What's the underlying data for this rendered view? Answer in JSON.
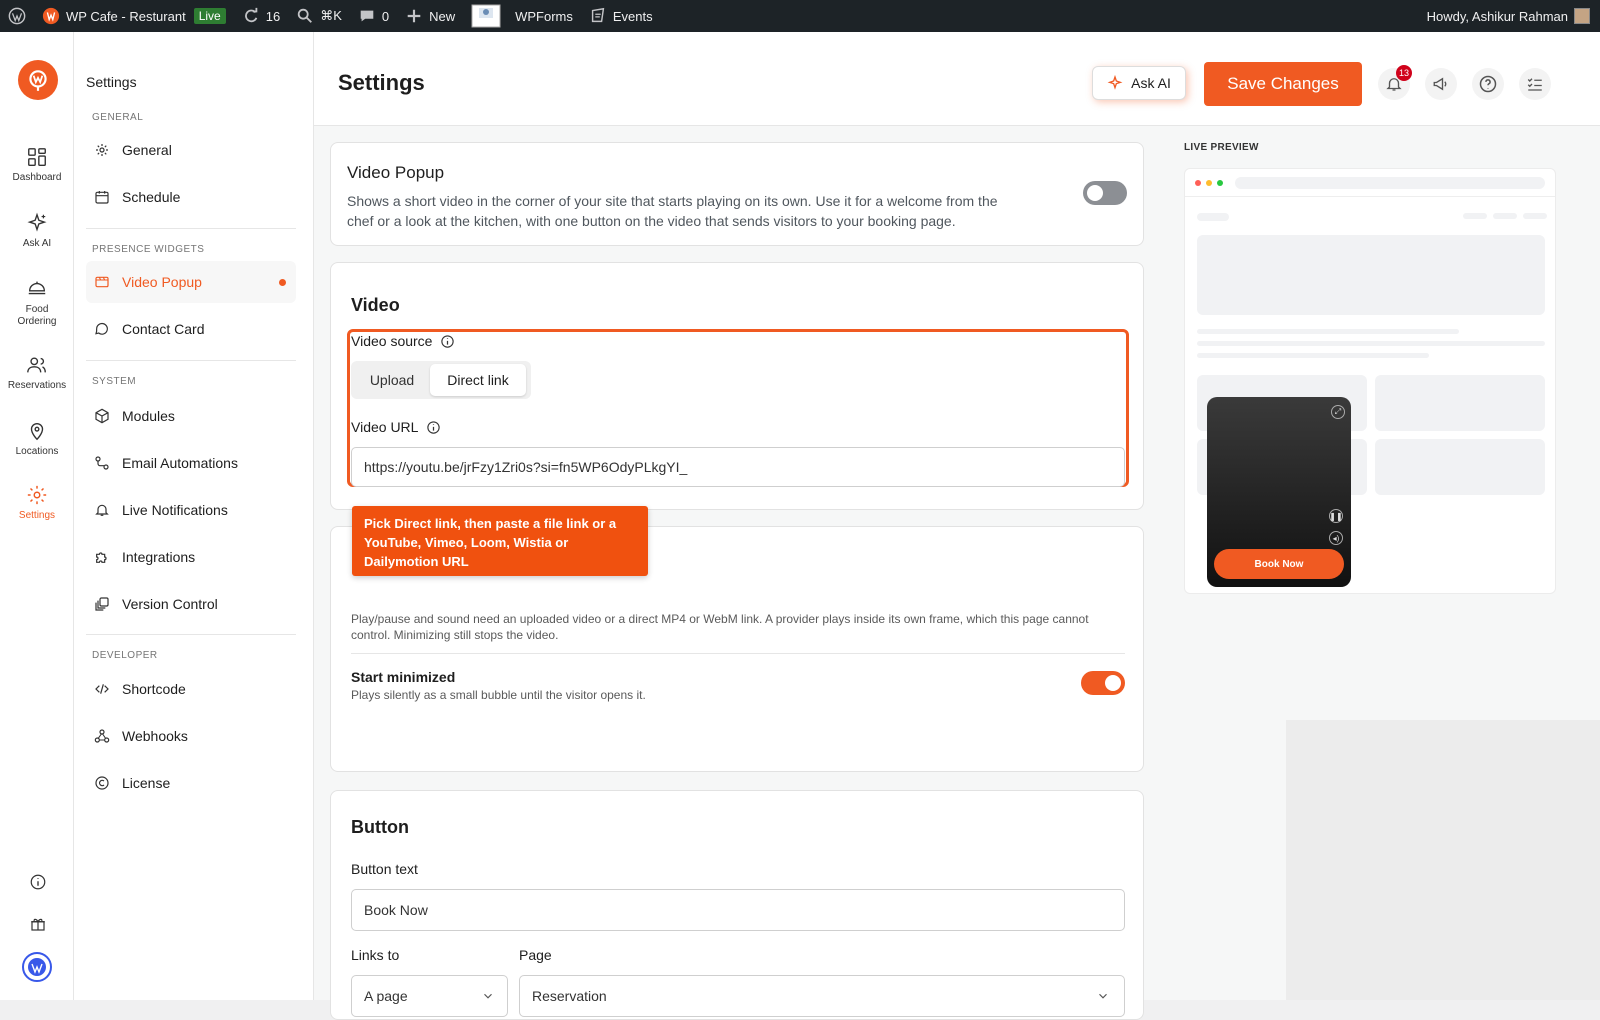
{
  "admin_bar": {
    "site_name": "WP Cafe - Resturant",
    "live_badge": "Live",
    "updates_count": "16",
    "search_shortcut": "⌘K",
    "comments_count": "0",
    "new_label": "New",
    "wpforms_label": "WPForms",
    "events_label": "Events",
    "greeting": "Howdy, Ashikur Rahman"
  },
  "icon_rail": {
    "items": [
      {
        "label": "Dashboard",
        "icon": "dashboard-icon"
      },
      {
        "label": "Ask AI",
        "icon": "sparkle-icon"
      },
      {
        "label": "Food Ordering",
        "icon": "food-icon"
      },
      {
        "label": "Reservations",
        "icon": "users-icon"
      },
      {
        "label": "Locations",
        "icon": "location-icon"
      },
      {
        "label": "Settings",
        "icon": "gear-icon"
      }
    ]
  },
  "sidebar": {
    "title": "Settings",
    "sections": {
      "general": "GENERAL",
      "presence": "PRESENCE WIDGETS",
      "system": "SYSTEM",
      "developer": "DEVELOPER"
    },
    "items": {
      "general": "General",
      "schedule": "Schedule",
      "video_popup": "Video Popup",
      "contact_card": "Contact Card",
      "modules": "Modules",
      "email_automations": "Email Automations",
      "live_notifications": "Live Notifications",
      "integrations": "Integrations",
      "version_control": "Version Control",
      "shortcode": "Shortcode",
      "webhooks": "Webhooks",
      "license": "License"
    }
  },
  "topbar": {
    "title": "Settings",
    "ask_ai": "Ask AI",
    "save": "Save Changes",
    "notification_count": "13"
  },
  "video_popup_card": {
    "title": "Video Popup",
    "description_line1": "Shows a short video in the corner of your site that starts playing on its own. Use it for a welcome from the",
    "description_line2": "chef or a look at the kitchen, with one button on the video that sends visitors to your booking page.",
    "enabled": false
  },
  "video_card": {
    "title": "Video",
    "source_label": "Video source",
    "source_options": [
      "Upload",
      "Direct link"
    ],
    "source_selected": "Direct link",
    "url_label": "Video URL",
    "url_value": "https://youtu.be/jrFzy1Zri0s?si=fn5WP6OdyPLkgYI_"
  },
  "tooltip": {
    "text": "Pick Direct link, then paste a file link or a YouTube, Vimeo, Loom, Wistia or Dailymotion URL"
  },
  "playback_card": {
    "note_line1": "Play/pause and sound need an uploaded video or a direct MP4 or WebM link. A provider plays inside its own frame, which this page cannot",
    "note_line2": "control. Minimizing still stops the video.",
    "start_minimized_label": "Start minimized",
    "start_minimized_desc": "Plays silently as a small bubble until the visitor opens it.",
    "start_minimized": true
  },
  "button_card": {
    "title": "Button",
    "button_text_label": "Button text",
    "button_text_value": "Book Now",
    "links_to_label": "Links to",
    "links_to_value": "A page",
    "page_label": "Page",
    "page_value": "Reservation"
  },
  "live_preview": {
    "label": "LIVE PREVIEW",
    "cta": "Book Now"
  },
  "colors": {
    "accent": "#f05a22",
    "admin_bar": "#1d2327",
    "toggle_off": "#8c8f94"
  }
}
